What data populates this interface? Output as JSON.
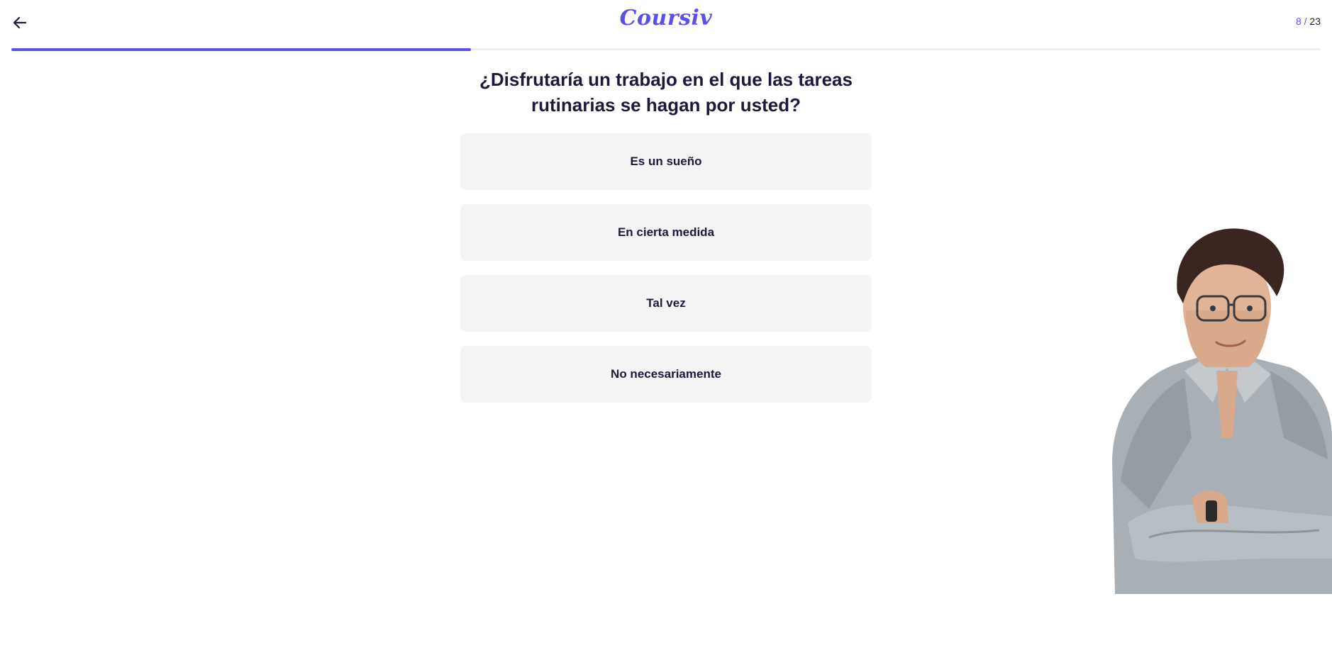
{
  "header": {
    "logo_text": "Coursiv",
    "progress": {
      "current": "8",
      "separator": "/",
      "total": "23",
      "fill_fraction": 0.351
    },
    "back_icon": "arrow-left-icon"
  },
  "quiz": {
    "question": "¿Disfrutaría un trabajo en el que las tareas rutinarias se hagan por usted?",
    "options": [
      {
        "label": "Es un sueño"
      },
      {
        "label": "En cierta medida"
      },
      {
        "label": "Tal vez"
      },
      {
        "label": "No necesariamente"
      }
    ]
  },
  "illustration": {
    "icon": "mascot-illustration"
  },
  "colors": {
    "accent": "#5a52e8",
    "text": "#1b1a3a",
    "option_bg": "#f4f4f5",
    "track": "#eeeeee"
  }
}
